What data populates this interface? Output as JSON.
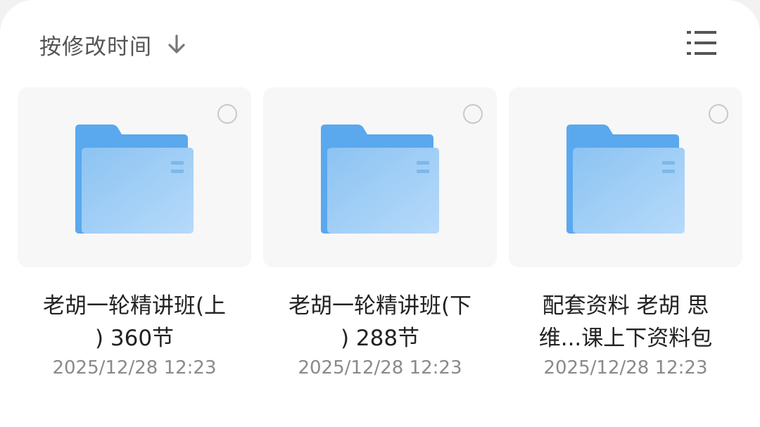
{
  "sort": {
    "label": "按修改时间",
    "direction_icon": "arrow-down-icon"
  },
  "view_toggle": {
    "icon": "list-view-icon"
  },
  "colors": {
    "folder_back": "#5aa8ee",
    "folder_front": "#a9d2f8",
    "accent_text": "#222222",
    "secondary_text": "#8a8a8a"
  },
  "items": [
    {
      "name_line1": "老胡一轮精讲班(上",
      "name_line2": ") 360节",
      "modified": "2025/12/28 12:23",
      "icon": "folder-icon"
    },
    {
      "name_line1": "老胡一轮精讲班(下",
      "name_line2": ") 288节",
      "modified": "2025/12/28 12:23",
      "icon": "folder-icon"
    },
    {
      "name_line1": "配套资料 老胡 思",
      "name_line2": "维...课上下资料包",
      "modified": "2025/12/28 12:23",
      "icon": "folder-icon"
    }
  ]
}
